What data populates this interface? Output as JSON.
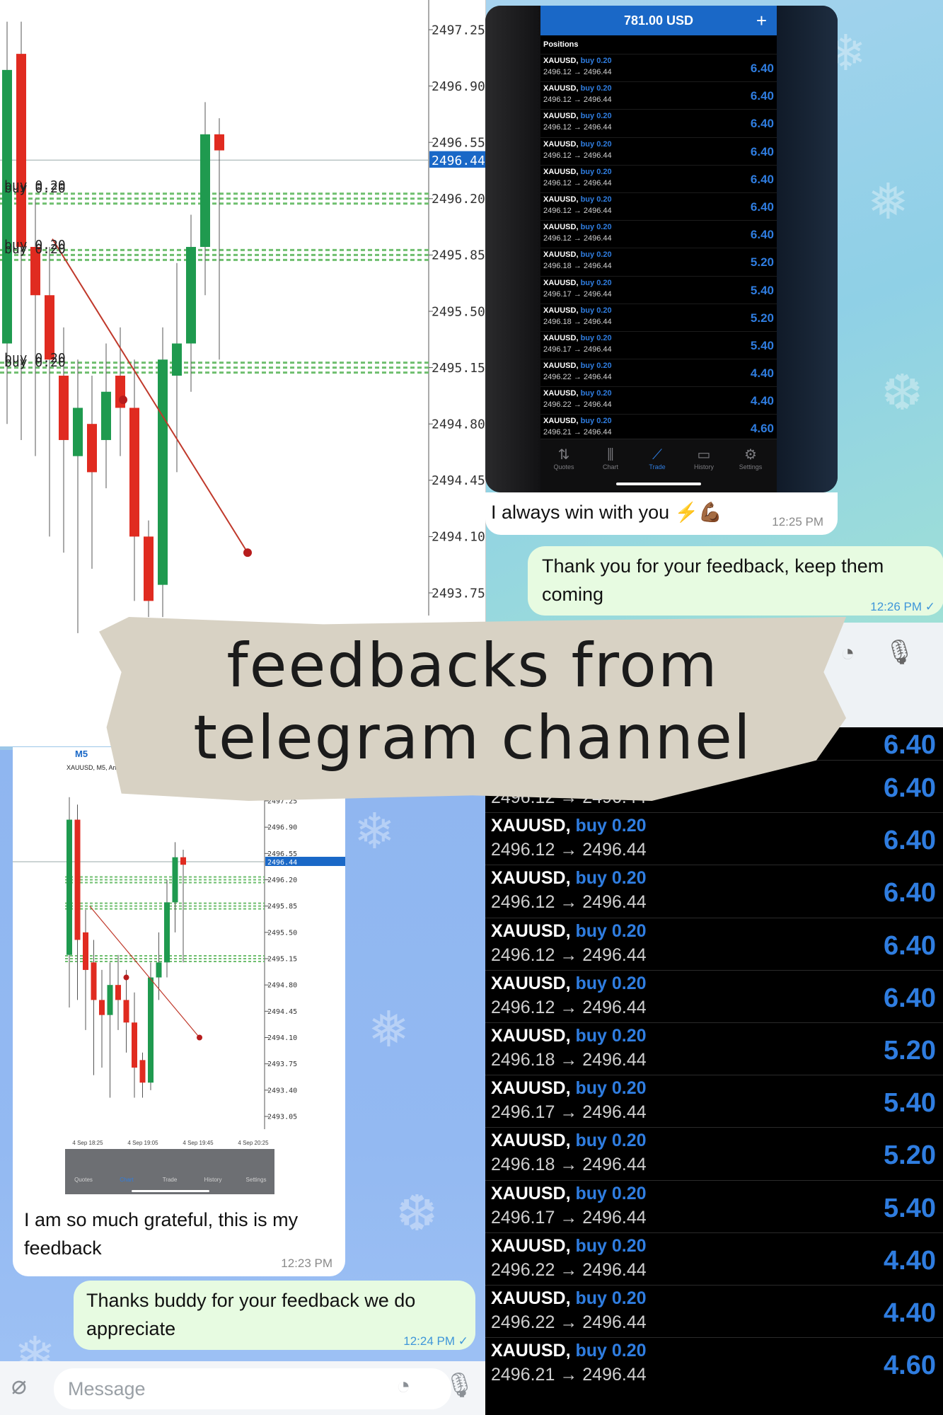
{
  "big_chart": {
    "price_ticks": [
      "2497.25",
      "2496.90",
      "2496.55",
      "2496.20",
      "2495.85",
      "2495.50",
      "2495.15",
      "2494.80",
      "2494.45",
      "2494.10",
      "2493.75"
    ],
    "current_price": "2496.44",
    "order_labels": [
      "buy 0.20",
      "buy 0.20",
      "buy 0.20",
      "buy 0.20",
      "buy 0.20",
      "buy 0.20"
    ]
  },
  "top_phone": {
    "balance": "781.00 USD",
    "plus": "+",
    "section": "Positions",
    "rows": [
      {
        "symbol": "XAUUSD,",
        "side": "buy 0.20",
        "prices": "2496.12 → 2496.44",
        "profit": "6.40"
      },
      {
        "symbol": "XAUUSD,",
        "side": "buy 0.20",
        "prices": "2496.12 → 2496.44",
        "profit": "6.40"
      },
      {
        "symbol": "XAUUSD,",
        "side": "buy 0.20",
        "prices": "2496.12 → 2496.44",
        "profit": "6.40"
      },
      {
        "symbol": "XAUUSD,",
        "side": "buy 0.20",
        "prices": "2496.12 → 2496.44",
        "profit": "6.40"
      },
      {
        "symbol": "XAUUSD,",
        "side": "buy 0.20",
        "prices": "2496.12 → 2496.44",
        "profit": "6.40"
      },
      {
        "symbol": "XAUUSD,",
        "side": "buy 0.20",
        "prices": "2496.12 → 2496.44",
        "profit": "6.40"
      },
      {
        "symbol": "XAUUSD,",
        "side": "buy 0.20",
        "prices": "2496.12 → 2496.44",
        "profit": "6.40"
      },
      {
        "symbol": "XAUUSD,",
        "side": "buy 0.20",
        "prices": "2496.18 → 2496.44",
        "profit": "5.20"
      },
      {
        "symbol": "XAUUSD,",
        "side": "buy 0.20",
        "prices": "2496.17 → 2496.44",
        "profit": "5.40"
      },
      {
        "symbol": "XAUUSD,",
        "side": "buy 0.20",
        "prices": "2496.18 → 2496.44",
        "profit": "5.20"
      },
      {
        "symbol": "XAUUSD,",
        "side": "buy 0.20",
        "prices": "2496.17 → 2496.44",
        "profit": "5.40"
      },
      {
        "symbol": "XAUUSD,",
        "side": "buy 0.20",
        "prices": "2496.22 → 2496.44",
        "profit": "4.40"
      },
      {
        "symbol": "XAUUSD,",
        "side": "buy 0.20",
        "prices": "2496.22 → 2496.44",
        "profit": "4.40"
      },
      {
        "symbol": "XAUUSD,",
        "side": "buy 0.20",
        "prices": "2496.21 → 2496.44",
        "profit": "4.60"
      }
    ],
    "nav": [
      "Quotes",
      "Chart",
      "Trade",
      "History",
      "Settings"
    ]
  },
  "chat_top": {
    "incoming": {
      "text": "I always win with you ⚡💪🏾",
      "time": "12:25 PM"
    },
    "outgoing": {
      "text": "Thank you for your feedback, keep them coming",
      "time": "12:26 PM ✓"
    }
  },
  "banner": {
    "line1": "feedbacks from",
    "line2": "telegram channel"
  },
  "small_chart": {
    "tab": "M5",
    "title": "XAUUSD, M5, Am",
    "price_ticks": [
      "2497.25",
      "2496.90",
      "2496.55",
      "2496.20",
      "2495.85",
      "2495.50",
      "2495.15",
      "2494.80",
      "2494.45",
      "2494.10",
      "2493.75",
      "2493.40",
      "2493.05"
    ],
    "current_price": "2496.44",
    "time_ticks": [
      "4 Sep 18:25",
      "4 Sep 19:05",
      "4 Sep 19:45",
      "4 Sep 20:25"
    ],
    "nav": [
      "Quotes",
      "Chart",
      "Trade",
      "History",
      "Settings"
    ]
  },
  "chat_bottom": {
    "incoming": {
      "text": "I am so much grateful, this is my feedback",
      "time": "12:23 PM"
    },
    "outgoing": {
      "text": "Thanks buddy for your feedback we do appreciate",
      "time": "12:24 PM ✓"
    }
  },
  "composer": {
    "placeholder": "Message"
  },
  "big_list": {
    "top_profit": "6.40",
    "rows": [
      {
        "symbol": "XAUUSD,",
        "side": "buy 0.20",
        "prices": "2496.12 → 2496.44",
        "profit": "6.40"
      },
      {
        "symbol": "XAUUSD,",
        "side": "buy 0.20",
        "prices": "2496.12 → 2496.44",
        "profit": "6.40"
      },
      {
        "symbol": "XAUUSD,",
        "side": "buy 0.20",
        "prices": "2496.12 → 2496.44",
        "profit": "6.40"
      },
      {
        "symbol": "XAUUSD,",
        "side": "buy 0.20",
        "prices": "2496.12 → 2496.44",
        "profit": "6.40"
      },
      {
        "symbol": "XAUUSD,",
        "side": "buy 0.20",
        "prices": "2496.12 → 2496.44",
        "profit": "6.40"
      },
      {
        "symbol": "XAUUSD,",
        "side": "buy 0.20",
        "prices": "2496.18 → 2496.44",
        "profit": "5.20"
      },
      {
        "symbol": "XAUUSD,",
        "side": "buy 0.20",
        "prices": "2496.17 → 2496.44",
        "profit": "5.40"
      },
      {
        "symbol": "XAUUSD,",
        "side": "buy 0.20",
        "prices": "2496.18 → 2496.44",
        "profit": "5.20"
      },
      {
        "symbol": "XAUUSD,",
        "side": "buy 0.20",
        "prices": "2496.17 → 2496.44",
        "profit": "5.40"
      },
      {
        "symbol": "XAUUSD,",
        "side": "buy 0.20",
        "prices": "2496.22 → 2496.44",
        "profit": "4.40"
      },
      {
        "symbol": "XAUUSD,",
        "side": "buy 0.20",
        "prices": "2496.22 → 2496.44",
        "profit": "4.40"
      },
      {
        "symbol": "XAUUSD,",
        "side": "buy 0.20",
        "prices": "2496.21 → 2496.44",
        "profit": "4.60"
      }
    ]
  },
  "colors": {
    "accent": "#2f7de0",
    "bull": "#1f9a4f",
    "bear": "#e02b20",
    "header": "#1a68c7"
  }
}
